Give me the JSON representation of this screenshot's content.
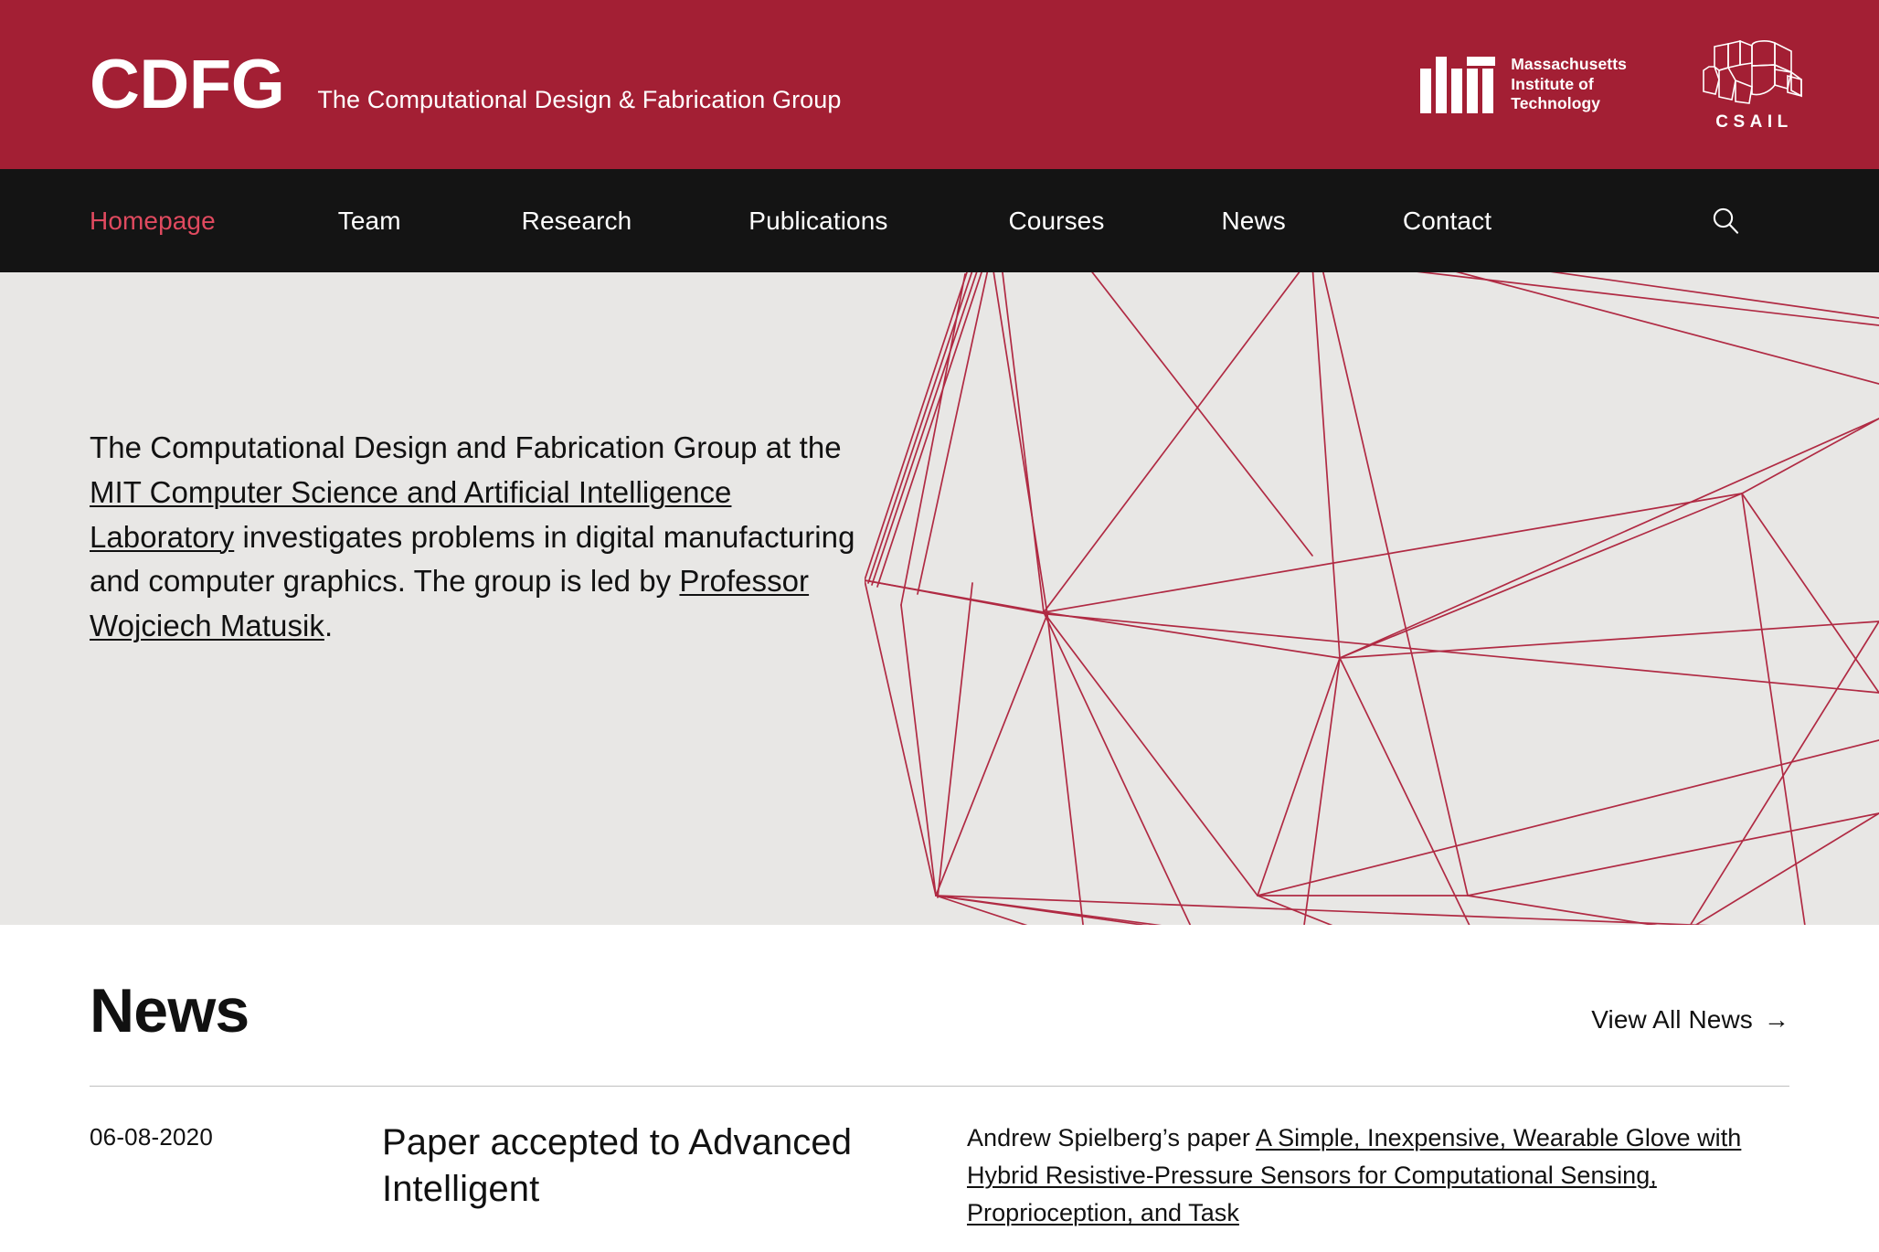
{
  "header": {
    "brand_acronym": "CDFG",
    "brand_tagline": "The Computational Design & Fabrication Group",
    "mit_wordmark_line1": "Massachusetts",
    "mit_wordmark_line2": "Institute of",
    "mit_wordmark_line3": "Technology",
    "csail_label": "CSAIL",
    "background_color": "#A31F34"
  },
  "nav": {
    "background_color": "#141414",
    "active_color": "#E04A5F",
    "items": [
      {
        "label": "Homepage",
        "active": true
      },
      {
        "label": "Team",
        "active": false
      },
      {
        "label": "Research",
        "active": false
      },
      {
        "label": "Publications",
        "active": false
      },
      {
        "label": "Courses",
        "active": false
      },
      {
        "label": "News",
        "active": false
      },
      {
        "label": "Contact",
        "active": false
      }
    ],
    "search_icon": "search-icon"
  },
  "hero": {
    "background_color": "#E8E7E5",
    "mesh_color": "#B02A43",
    "paragraph": {
      "part1": "The Computational Design and Fabrication Group at the ",
      "link1": "MIT Computer Science and Artificial Intelligence Laboratory",
      "part2": " investigates problems in digital manufacturing and computer graphics. The group is led by ",
      "link2": "Professor Wojciech Matusik",
      "part3": "."
    }
  },
  "news": {
    "title": "News",
    "view_all_label": "View All News",
    "view_all_arrow": "→",
    "items": [
      {
        "date": "06-08-2020",
        "headline": "Paper accepted to Advanced Intelligent",
        "body_prefix": "Andrew Spielberg’s paper ",
        "body_link": "A Simple, Inexpensive, Wearable Glove with Hybrid Resistive-Pressure Sensors for Computational Sensing, Proprioception, and Task"
      }
    ]
  }
}
